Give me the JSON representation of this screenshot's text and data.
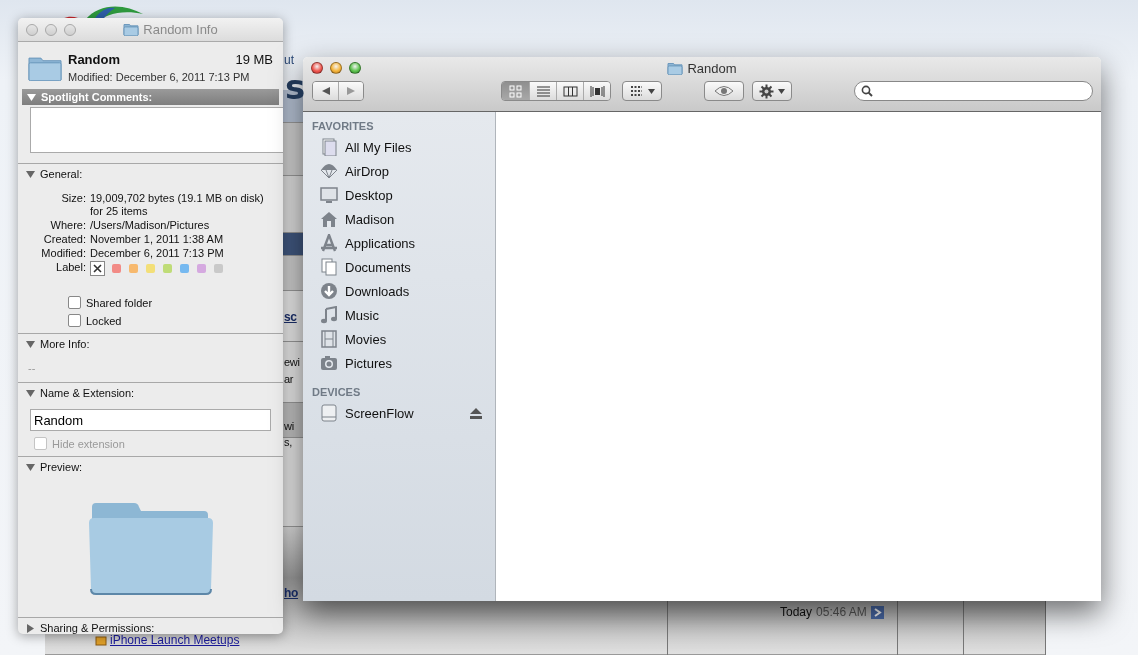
{
  "background_page": {
    "logo_letter": "s",
    "tagline_fragment": "ut",
    "fragments": [
      {
        "text": "sc",
        "kind": "link"
      },
      {
        "text": "ewi",
        "kind": "text"
      },
      {
        "text": "ar",
        "kind": "text"
      },
      {
        "text": "wi",
        "kind": "text"
      },
      {
        "text": "s,",
        "kind": "text"
      },
      {
        "text": "ho",
        "kind": "link"
      }
    ],
    "thread_link": "iPhone Launch Meetups",
    "last_post_day": "Today",
    "last_post_time": "05:46 AM"
  },
  "info_window": {
    "title": "Random Info",
    "active": false,
    "name": "Random",
    "size": "19 MB",
    "modified": "Modified: December 6, 2011 7:13 PM",
    "sections": [
      {
        "kind": "comments",
        "title": "Spotlight Comments:",
        "expanded": true,
        "selected": true
      },
      {
        "kind": "general",
        "title": "General:",
        "expanded": true,
        "selected": false,
        "fields": [
          {
            "label": "Size:",
            "value": "19,009,702 bytes (19.1 MB on disk) for 25 items"
          },
          {
            "label": "Where:",
            "value": "/Users/Madison/Pictures"
          },
          {
            "label": "Created:",
            "value": "November 1, 2011 1:38 AM"
          },
          {
            "label": "Modified:",
            "value": "December 6, 2011 7:13 PM"
          }
        ],
        "label_title": "Label:",
        "labels": [
          {
            "kind": "none",
            "selected": true
          },
          {
            "kind": "color",
            "color": "#f28b86",
            "selected": false
          },
          {
            "kind": "color",
            "color": "#f7b96e",
            "selected": false
          },
          {
            "kind": "color",
            "color": "#f3df78",
            "selected": false
          },
          {
            "kind": "color",
            "color": "#bfdc77",
            "selected": false
          },
          {
            "kind": "color",
            "color": "#76b9f0",
            "selected": false
          },
          {
            "kind": "color",
            "color": "#d5a9e0",
            "selected": false
          },
          {
            "kind": "color",
            "color": "#c9c9c9",
            "selected": false
          }
        ],
        "checkboxes": [
          {
            "label": "Shared folder",
            "checked": false
          },
          {
            "label": "Locked",
            "checked": false
          }
        ]
      },
      {
        "kind": "more_info",
        "title": "More Info:",
        "expanded": true,
        "selected": false,
        "value": "--"
      },
      {
        "kind": "name",
        "title": "Name & Extension:",
        "expanded": true,
        "selected": false,
        "value": "Random",
        "hide_extension": {
          "label": "Hide extension",
          "checked": false,
          "disabled": true
        }
      },
      {
        "kind": "preview",
        "title": "Preview:",
        "expanded": true,
        "selected": false
      },
      {
        "kind": "sharing",
        "title": "Sharing & Permissions:",
        "expanded": false,
        "selected": false
      }
    ]
  },
  "finder_window": {
    "title": "Random",
    "active": true,
    "view_modes": [
      {
        "kind": "icon",
        "selected": true
      },
      {
        "kind": "list",
        "selected": false
      },
      {
        "kind": "column",
        "selected": false
      },
      {
        "kind": "coverflow",
        "selected": false
      }
    ],
    "sidebar": [
      {
        "heading": "FAVORITES",
        "items": [
          {
            "label": "All My Files",
            "kind": "files",
            "selected": false
          },
          {
            "label": "AirDrop",
            "kind": "airdrop",
            "selected": false
          },
          {
            "label": "Desktop",
            "kind": "desktop",
            "selected": false
          },
          {
            "label": "Madison",
            "kind": "home",
            "selected": false
          },
          {
            "label": "Applications",
            "kind": "apps",
            "selected": false
          },
          {
            "label": "Documents",
            "kind": "docs",
            "selected": false
          },
          {
            "label": "Downloads",
            "kind": "downloads",
            "selected": false
          },
          {
            "label": "Music",
            "kind": "music",
            "selected": false
          },
          {
            "label": "Movies",
            "kind": "movies",
            "selected": false
          },
          {
            "label": "Pictures",
            "kind": "pictures",
            "selected": false
          }
        ]
      },
      {
        "heading": "DEVICES",
        "items": [
          {
            "label": "ScreenFlow",
            "kind": "drive",
            "selected": false,
            "ejectable": true
          }
        ]
      }
    ]
  }
}
